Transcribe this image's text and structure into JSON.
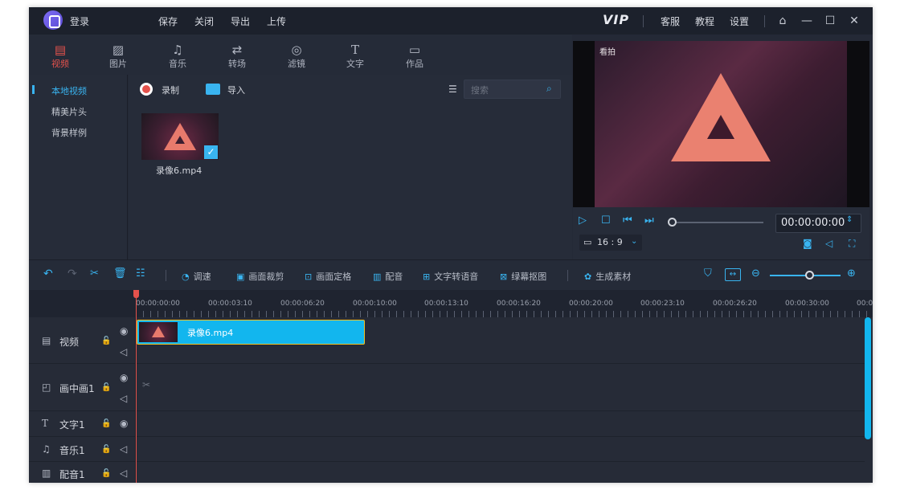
{
  "titlebar": {
    "login": "登录",
    "menu": [
      "保存",
      "关闭",
      "导出",
      "上传"
    ],
    "vip": "VIP",
    "links": [
      "客服",
      "教程",
      "设置"
    ]
  },
  "media_tabs": [
    {
      "label": "视频",
      "icon": "film-icon",
      "active": true
    },
    {
      "label": "图片",
      "icon": "image-icon"
    },
    {
      "label": "音乐",
      "icon": "music-icon"
    },
    {
      "label": "转场",
      "icon": "transition-icon"
    },
    {
      "label": "滤镜",
      "icon": "filter-icon"
    },
    {
      "label": "文字",
      "icon": "text-icon"
    },
    {
      "label": "作品",
      "icon": "folder-icon"
    }
  ],
  "categories": [
    "本地视频",
    "精美片头",
    "背景样例"
  ],
  "media_toolbar": {
    "record": "录制",
    "import": "导入",
    "search_placeholder": "搜索"
  },
  "media_items": [
    {
      "name": "录像6.mp4",
      "selected": true
    }
  ],
  "preview": {
    "watermark": "看拍",
    "time": "00:00:00:00",
    "ratio": "16 : 9"
  },
  "edit_toolbar": [
    "调速",
    "画面裁剪",
    "画面定格",
    "配音",
    "文字转语音",
    "绿幕抠图",
    "生成素材"
  ],
  "ruler": [
    "00:00:00:00",
    "00:00:03:10",
    "00:00:06:20",
    "00:00:10:00",
    "00:00:13:10",
    "00:00:16:20",
    "00:00:20:00",
    "00:00:23:10",
    "00:00:26:20",
    "00:00:30:00",
    "00:0"
  ],
  "tracks": [
    {
      "name": "视频"
    },
    {
      "name": "画中画1"
    },
    {
      "name": "文字1"
    },
    {
      "name": "音乐1"
    },
    {
      "name": "配音1"
    }
  ],
  "clip": {
    "label": "录像6.mp4"
  },
  "colors": {
    "accent": "#39b4f0",
    "active_tab": "#e5524c",
    "clip": "#12b6ee"
  }
}
